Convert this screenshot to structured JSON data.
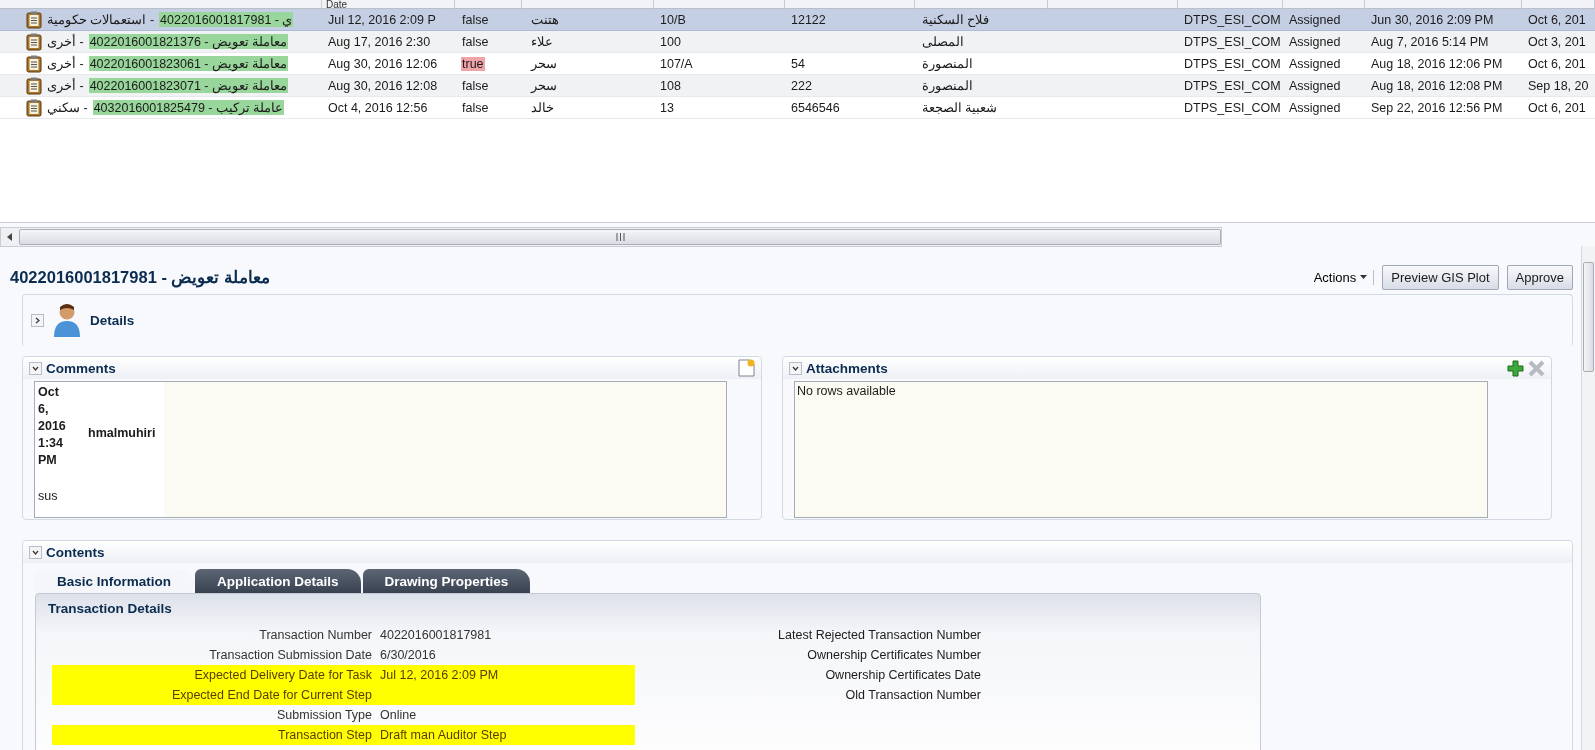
{
  "table": {
    "columns": [
      "",
      "Date",
      "",
      "",
      "",
      "",
      "",
      "",
      "",
      "",
      "",
      ""
    ],
    "rows": [
      {
        "selected": true,
        "category": "- استعمالات حكومية",
        "transaction": "ي - 4022016001817981",
        "date": "Jul 12, 2016 2:09 P",
        "flag": "false",
        "flag_highlight": false,
        "name": "هتنت",
        "unit": "10/B",
        "plot": "12122",
        "area": "فلاح السكنية",
        "group": "DTPS_ESI_COM",
        "status": "Assigned",
        "assigned": "Jun 30, 2016 2:09 PM",
        "due": "Oct 6, 201"
      },
      {
        "selected": false,
        "category": "- أخرى",
        "transaction": "معاملة تعويض - 4022016001821376",
        "date": "Aug 17, 2016 2:30",
        "flag": "false",
        "flag_highlight": false,
        "name": "علاء",
        "unit": "100",
        "area": "المصلى",
        "group": "DTPS_ESI_COM",
        "status": "Assigned",
        "assigned": "Aug 7, 2016 5:14 PM",
        "due": "Oct 3, 201"
      },
      {
        "selected": false,
        "category": "- أخرى",
        "transaction": "معاملة تعويض - 4022016001823061",
        "date": "Aug 30, 2016 12:06",
        "flag": "true",
        "flag_highlight": true,
        "name": "سحر",
        "unit": "107/A",
        "plot": "54",
        "area": "المنصورة",
        "group": "DTPS_ESI_COM",
        "status": "Assigned",
        "assigned": "Aug 18, 2016 12:06 PM",
        "due": "Oct 6, 201"
      },
      {
        "selected": false,
        "category": "- أخرى",
        "transaction": "معاملة تعويض - 4022016001823071",
        "date": "Aug 30, 2016 12:08",
        "flag": "false",
        "flag_highlight": false,
        "name": "سحر",
        "unit": "108",
        "plot": "222",
        "area": "المنصورة",
        "group": "DTPS_ESI_COM",
        "status": "Assigned",
        "assigned": "Aug 18, 2016 12:08 PM",
        "due": "Sep 18, 20"
      },
      {
        "selected": false,
        "category": "- سكني",
        "transaction": "عاملة تركيب - 4032016001825479",
        "date": "Oct 4, 2016 12:56",
        "flag": "false",
        "flag_highlight": false,
        "name": "خالد",
        "unit": "13",
        "plot": "6546546",
        "area": "شعبية الصجعة",
        "group": "DTPS_ESI_COM",
        "status": "Assigned",
        "assigned": "Sep 22, 2016 12:56 PM",
        "due": "Oct 6, 201"
      }
    ]
  },
  "detail": {
    "title": "معاملة تعويض - 4022016001817981",
    "actions": "Actions",
    "buttons": [
      "Preview GIS Plot",
      "Approve"
    ]
  },
  "details_panel": {
    "title": "Details",
    "expanded": false
  },
  "comments": {
    "title": "Comments",
    "expanded": true,
    "items": [
      {
        "date": "Oct 6, 2016 1:34 PM",
        "author": "hmalmuhiri",
        "text": "sus"
      }
    ]
  },
  "attachments": {
    "title": "Attachments",
    "expanded": true,
    "empty_text": "No rows available"
  },
  "contents": {
    "title": "Contents",
    "expanded": true,
    "tabs": [
      {
        "label": "Basic Information",
        "selected": true
      },
      {
        "label": "Application Details",
        "selected": false
      },
      {
        "label": "Drawing Properties",
        "selected": false
      }
    ],
    "section_title": "Transaction Details",
    "left_fields": [
      {
        "label": "Transaction Number",
        "value": "4022016001817981",
        "highlighted": false
      },
      {
        "label": "Transaction Submission Date",
        "value": "6/30/2016",
        "highlighted": false
      },
      {
        "label": "Expected Delivery Date for Task",
        "value": "Jul 12, 2016 2:09 PM",
        "highlighted": true
      },
      {
        "label": "Expected End Date for Current Step",
        "highlighted": true
      },
      {
        "label": "Submission Type",
        "value": "Online",
        "highlighted": false
      },
      {
        "label": "Transaction Step",
        "value": "Draft man Auditor Step",
        "highlighted": true
      }
    ],
    "right_fields": [
      {
        "label": "Latest Rejected Transaction Number"
      },
      {
        "label": "Ownership Certificates Number"
      },
      {
        "label": "Ownership Certificates Date"
      },
      {
        "label": "Old Transaction Number"
      }
    ]
  }
}
